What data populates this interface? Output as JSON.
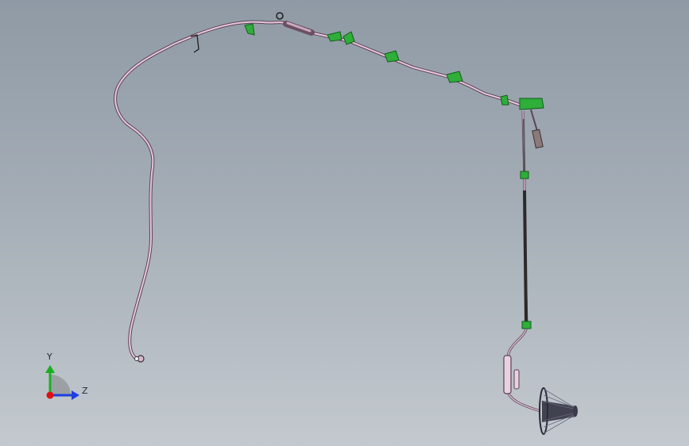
{
  "viewport": {
    "background_top": "#8f9aa5",
    "background_bottom": "#c3c9ce"
  },
  "model": {
    "part": "wire-harness-assembly",
    "cable_color": "#c99ab8",
    "cable_outline": "#5b4356",
    "clip_color": "#2fae3a",
    "conduit_color": "#2a2a2a",
    "antenna_color": "#3b3b4b"
  },
  "triad": {
    "y_label": "Y",
    "z_label": "Z",
    "x_color": "#e01010",
    "y_color": "#18b01e",
    "z_color": "#1f3fe0"
  }
}
